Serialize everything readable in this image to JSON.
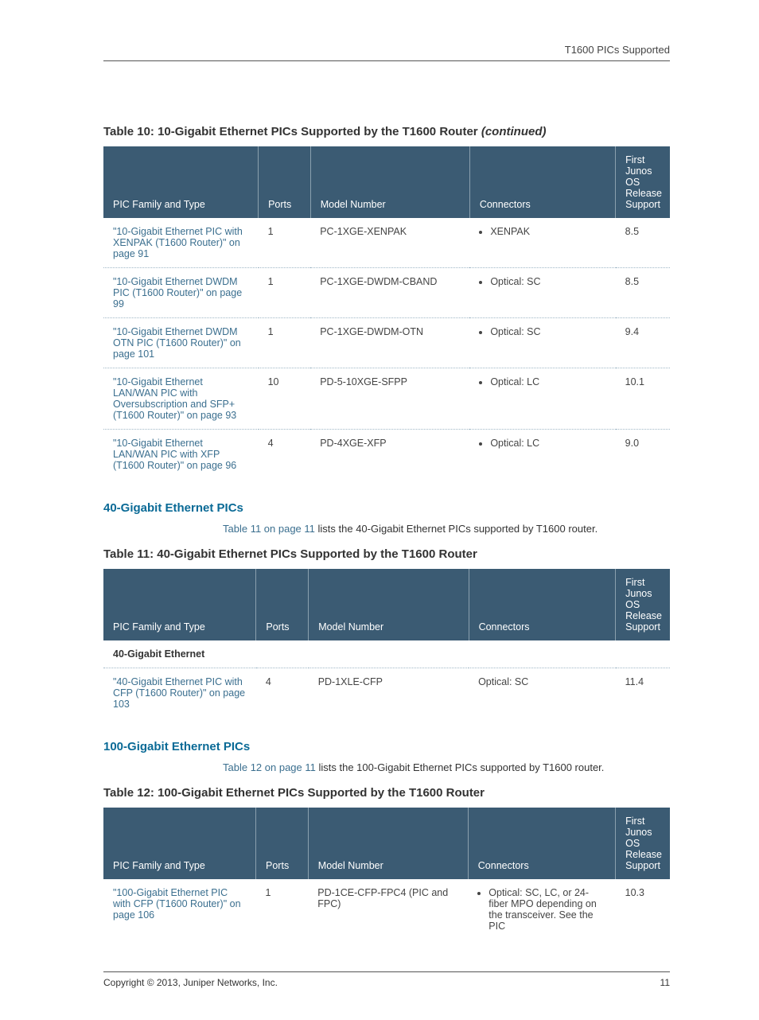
{
  "headerText": "T1600 PICs Supported",
  "table10": {
    "caption": "Table 10: 10-Gigabit Ethernet PICs Supported by the T1600 Router",
    "captionCont": "(continued)",
    "cols": {
      "c1": "PIC Family and Type",
      "c2": "Ports",
      "c3": "Model Number",
      "c4": "Connectors",
      "c5": "First Junos OS Release Support"
    },
    "rows": [
      {
        "link": "\"10-Gigabit Ethernet PIC with XENPAK (T1600 Router)\" on page 91",
        "ports": "1",
        "model": "PC-1XGE-XENPAK",
        "conn": "XENPAK",
        "rel": "8.5"
      },
      {
        "link": "\"10-Gigabit Ethernet DWDM PIC (T1600 Router)\" on page 99",
        "ports": "1",
        "model": "PC-1XGE-DWDM-CBAND",
        "conn": "Optical: SC",
        "rel": "8.5"
      },
      {
        "link": "\"10-Gigabit Ethernet DWDM OTN PIC (T1600 Router)\" on page 101",
        "ports": "1",
        "model": "PC-1XGE-DWDM-OTN",
        "conn": "Optical: SC",
        "rel": "9.4"
      },
      {
        "link": "\"10-Gigabit Ethernet LAN/WAN PIC with Oversubscription and SFP+ (T1600 Router)\" on page 93",
        "ports": "10",
        "model": "PD-5-10XGE-SFPP",
        "conn": "Optical: LC",
        "rel": "10.1"
      },
      {
        "link": "\"10-Gigabit Ethernet LAN/WAN PIC with XFP (T1600 Router)\" on page 96",
        "ports": "4",
        "model": "PD-4XGE-XFP",
        "conn": "Optical: LC",
        "rel": "9.0"
      }
    ]
  },
  "sec40": {
    "heading": "40-Gigabit Ethernet PICs",
    "paraLink": "Table 11 on page 11",
    "paraRest": " lists the 40-Gigabit Ethernet PICs supported by T1600 router."
  },
  "table11": {
    "caption": "Table 11: 40-Gigabit Ethernet PICs Supported by the T1600 Router",
    "cols": {
      "c1": "PIC Family and Type",
      "c2": "Ports",
      "c3": "Model Number",
      "c4": "Connectors",
      "c5": "First Junos OS Release Support"
    },
    "subhead": "40-Gigabit Ethernet",
    "row": {
      "link": "\"40-Gigabit Ethernet PIC with CFP (T1600 Router)\" on page 103",
      "ports": "4",
      "model": "PD-1XLE-CFP",
      "conn": "Optical: SC",
      "rel": "11.4"
    }
  },
  "sec100": {
    "heading": "100-Gigabit Ethernet PICs",
    "paraLink": "Table 12 on page 11",
    "paraRest": " lists the 100-Gigabit Ethernet PICs supported by T1600 router."
  },
  "table12": {
    "caption": "Table 12: 100-Gigabit Ethernet PICs Supported by the T1600 Router",
    "cols": {
      "c1": "PIC Family and Type",
      "c2": "Ports",
      "c3": "Model Number",
      "c4": "Connectors",
      "c5": "First Junos OS Release Support"
    },
    "row": {
      "link": "\"100-Gigabit Ethernet PIC with CFP (T1600 Router)\" on page 106",
      "ports": "1",
      "model": "PD-1CE-CFP-FPC4 (PIC and FPC)",
      "conn": "Optical: SC, LC, or 24-fiber MPO depending on the transceiver. See the PIC",
      "rel": "10.3"
    }
  },
  "footer": {
    "copyright": "Copyright © 2013, Juniper Networks, Inc.",
    "page": "11"
  }
}
